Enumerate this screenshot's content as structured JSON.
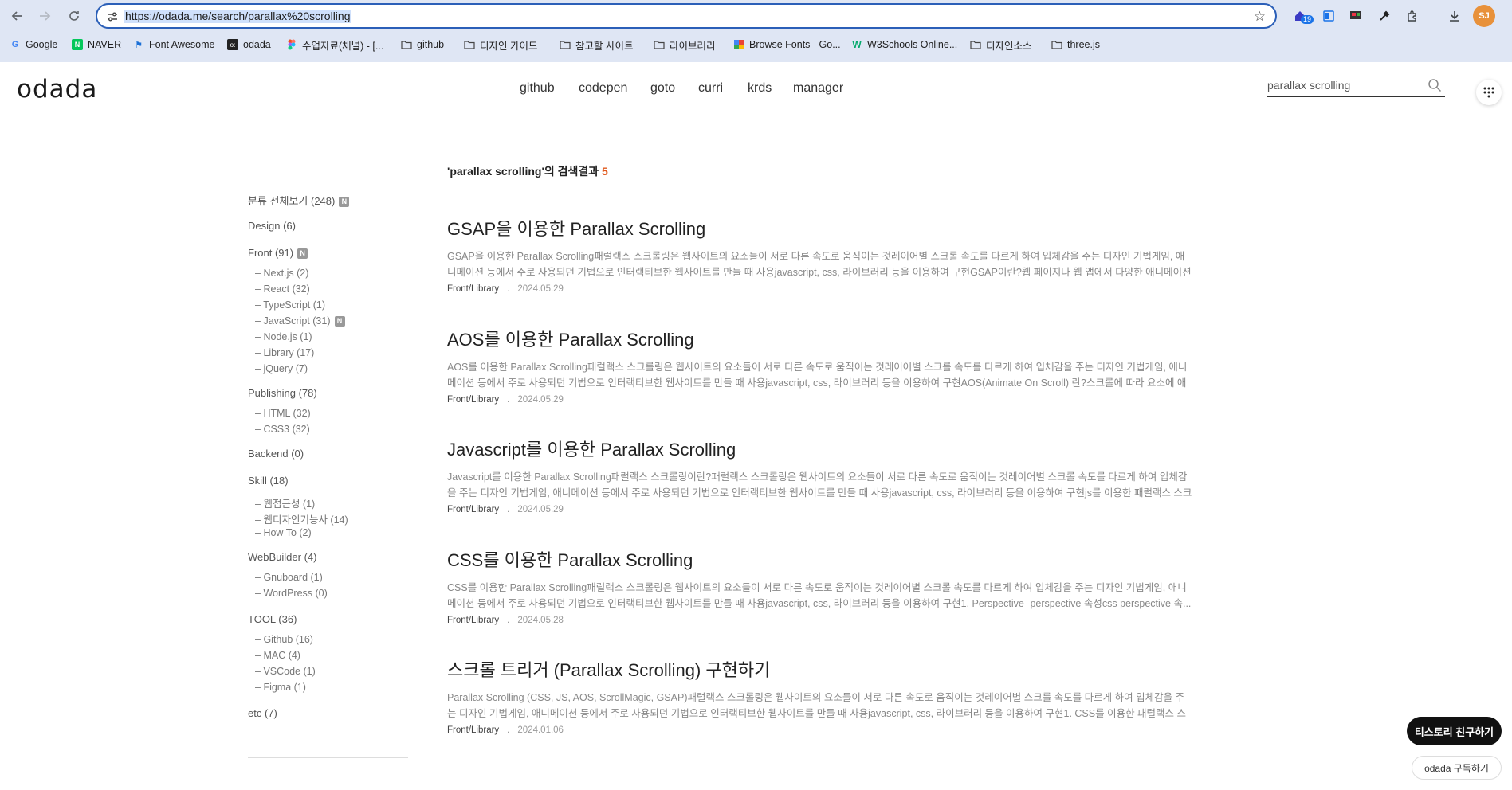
{
  "browser": {
    "url": "https://odada.me/search/parallax%20scrolling",
    "extension_badge": "19",
    "profile_initials": "SJ",
    "bookmarks": [
      {
        "label": "Google",
        "icon": "google-icon"
      },
      {
        "label": "NAVER",
        "icon": "naver-icon"
      },
      {
        "label": "Font Awesome",
        "icon": "flag-icon"
      },
      {
        "label": "odada",
        "icon": "odada-icon"
      },
      {
        "label": "수업자료(채널) - [...",
        "icon": "figma-icon"
      },
      {
        "label": "github",
        "icon": "folder-icon"
      },
      {
        "label": "디자인 가이드",
        "icon": "folder-icon"
      },
      {
        "label": "참고할 사이트",
        "icon": "folder-icon"
      },
      {
        "label": "라이브러리",
        "icon": "folder-icon"
      },
      {
        "label": "Browse Fonts - Go...",
        "icon": "google-fonts-icon"
      },
      {
        "label": "W3Schools Online...",
        "icon": "w3schools-icon"
      },
      {
        "label": "디자인소스",
        "icon": "folder-icon"
      },
      {
        "label": "three.js",
        "icon": "folder-icon"
      }
    ]
  },
  "site": {
    "logo": "odada",
    "nav": [
      "github",
      "codepen",
      "goto",
      "curri",
      "krds",
      "manager"
    ],
    "search_value": "parallax scrolling"
  },
  "sidebar": {
    "all": "분류 전체보기 (248)",
    "new_badge": "N",
    "categories": [
      {
        "label": "Design (6)",
        "subs": []
      },
      {
        "label": "Front (91)",
        "new": true,
        "subs": [
          "Next.js (2)",
          "React (32)",
          "TypeScript (1)",
          "JavaScript (31)",
          "Node.js (1)",
          "Library (17)",
          "jQuery (7)"
        ]
      },
      {
        "label": "Publishing (78)",
        "subs": [
          "HTML (32)",
          "CSS3 (32)"
        ]
      },
      {
        "label": "Backend (0)",
        "subs": []
      },
      {
        "label": "Skill (18)",
        "subs": [
          "웹접근성 (1)",
          "웹디자인기능사 (14)",
          "How To (2)"
        ]
      },
      {
        "label": "WebBuilder (4)",
        "subs": [
          "Gnuboard (1)",
          "WordPress (0)"
        ]
      },
      {
        "label": "TOOL (36)",
        "subs": [
          "Github (16)",
          "MAC (4)",
          "VSCode (1)",
          "Figma (1)"
        ]
      },
      {
        "label": "etc (7)",
        "subs": []
      }
    ]
  },
  "results": {
    "heading": "'parallax scrolling'의 검색결과",
    "count": "5",
    "posts": [
      {
        "title": "GSAP을 이용한 Parallax Scrolling",
        "excerpt": "GSAP을 이용한 Parallax Scrolling패럴랙스 스크롤링은 웹사이트의 요소들이 서로 다른 속도로 움직이는 것레이어별 스크롤 속도를 다르게 하여 입체감을 주는 디자인 기법게임, 애니메이션 등에서 주로 사용되던 기법으로 인터랙티브한 웹사이트를 만들 때 사용javascript, css, 라이브러리 등을 이용하여 구현GSAP이란?웹 페이지나 웹 앱에서 다양한 애니메이션 ...",
        "category": "Front/Library",
        "date": "2024.05.29"
      },
      {
        "title": "AOS를 이용한 Parallax Scrolling",
        "excerpt": "AOS를 이용한 Parallax Scrolling패럴랙스 스크롤링은 웹사이트의 요소들이 서로 다른 속도로 움직이는 것레이어별 스크롤 속도를 다르게 하여 입체감을 주는 디자인 기법게임, 애니메이션 등에서 주로 사용되던 기법으로 인터랙티브한 웹사이트를 만들 때 사용javascript, css, 라이브러리 등을 이용하여 구현AOS(Animate On Scroll) 란?스크롤에 따라 요소에 애니...",
        "category": "Front/Library",
        "date": "2024.05.29"
      },
      {
        "title": "Javascript를 이용한 Parallax Scrolling",
        "excerpt": "Javascript를 이용한 Parallax Scrolling패럴랙스 스크롤링이란?패럴랙스 스크롤링은 웹사이트의 요소들이 서로 다른 속도로 움직이는 것레이어별 스크롤 속도를 다르게 하여 입체감을 주는 디자인 기법게임, 애니메이션 등에서 주로 사용되던 기법으로 인터랙티브한 웹사이트를 만들 때 사용javascript, css, 라이브러리 등을 이용하여 구현js를 이용한 패럴랙스 스크롤...",
        "category": "Front/Library",
        "date": "2024.05.29"
      },
      {
        "title": "CSS를 이용한 Parallax Scrolling",
        "excerpt": "CSS를 이용한 Parallax Scrolling패럴랙스 스크롤링은 웹사이트의 요소들이 서로 다른 속도로 움직이는 것레이어별 스크롤 속도를 다르게 하여 입체감을 주는 디자인 기법게임, 애니메이션 등에서 주로 사용되던 기법으로 인터랙티브한 웹사이트를 만들 때 사용javascript, css, 라이브러리 등을 이용하여 구현1. Perspective- perspective 속성css perspective 속...",
        "category": "Front/Library",
        "date": "2024.05.28"
      },
      {
        "title": "스크롤 트리거 (Parallax Scrolling) 구현하기",
        "excerpt": "Parallax Scrolling (CSS, JS, AOS, ScrollMagic, GSAP)패럴랙스 스크롤링은 웹사이트의 요소들이 서로 다른 속도로 움직이는 것레이어별 스크롤 속도를 다르게 하여 입체감을 주는 디자인 기법게임, 애니메이션 등에서 주로 사용되던 기법으로 인터랙티브한 웹사이트를 만들 때 사용javascript, css, 라이브러리 등을 이용하여 구현1. CSS를 이용한 패럴랙스 스크롤...",
        "category": "Front/Library",
        "date": "2024.01.06"
      }
    ]
  },
  "floating": {
    "friend_button": "티스토리 친구하기",
    "subscribe_button": "odada 구독하기"
  },
  "colors": {
    "accent": "#e05a1e",
    "omnibox_border": "#2b5fb8",
    "chrome_bg": "#dfe6f4"
  }
}
